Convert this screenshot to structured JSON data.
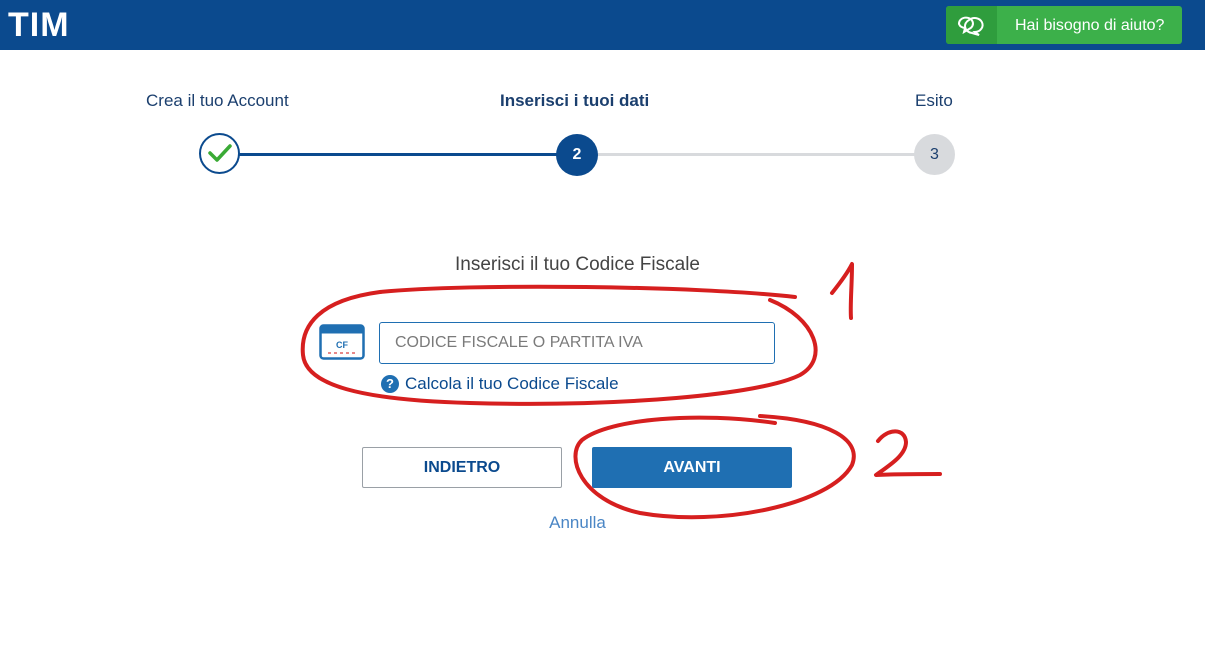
{
  "header": {
    "logo": "TIM",
    "help_label": "Hai bisogno di aiuto?",
    "help_icon": "chat-bubbles-icon"
  },
  "steps": [
    {
      "label": "Crea il tuo Account",
      "state": "done"
    },
    {
      "label": "Inserisci i tuoi dati",
      "number": "2",
      "state": "active"
    },
    {
      "label": "Esito",
      "number": "3",
      "state": "pending"
    }
  ],
  "form": {
    "title": "Inserisci il tuo Codice Fiscale",
    "card_icon_text": "CF",
    "input_placeholder": "CODICE FISCALE O PARTITA IVA",
    "input_value": "",
    "calc_link": "Calcola il tuo Codice Fiscale",
    "calc_icon_text": "?"
  },
  "buttons": {
    "back": "INDIETRO",
    "next": "AVANTI",
    "cancel": "Annulla"
  },
  "annotations": {
    "label_1": "1",
    "label_2": "2",
    "color": "#d61f1f"
  },
  "colors": {
    "brand_blue": "#0b4a8e",
    "button_blue": "#1f6fb2",
    "help_green": "#3cb04a",
    "check_green": "#3aaa35"
  }
}
